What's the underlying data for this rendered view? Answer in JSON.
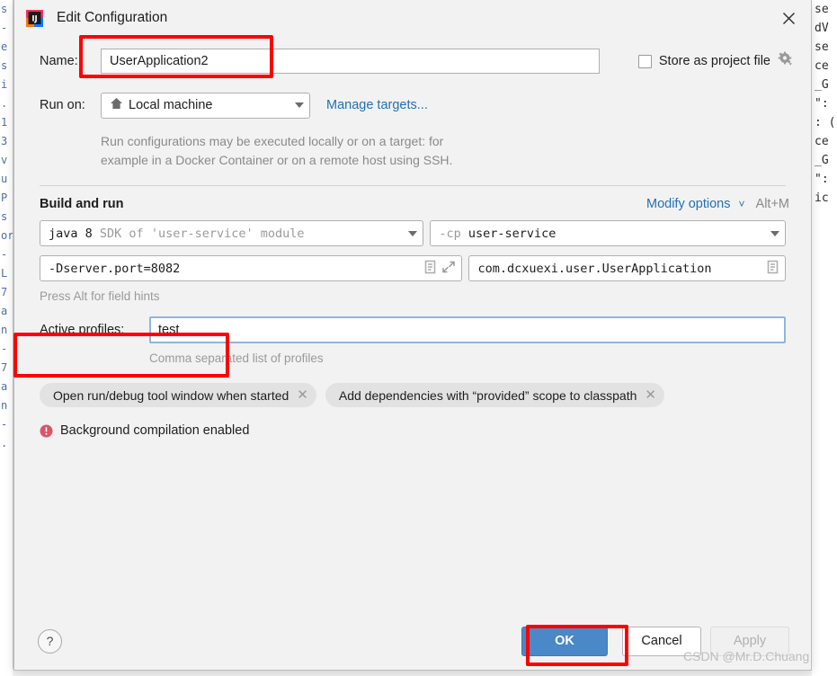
{
  "window": {
    "title": "Edit Configuration",
    "app_icon": "intellij-idea-icon",
    "close_icon": "close-icon"
  },
  "name_row": {
    "label": "Name:",
    "value": "UserApplication2",
    "placeholder": "Name",
    "store_as_project_file": {
      "label": "Store as project file",
      "checked": false,
      "gear_icon": "gear-icon"
    }
  },
  "run_on_row": {
    "label": "Run on:",
    "value": "Local machine",
    "icon": "home-icon",
    "manage_targets_link": "Manage targets..."
  },
  "description": {
    "line1": "Run configurations may be executed locally or on a target: for",
    "line2": "example in a Docker Container or on a remote host using SSH."
  },
  "build_and_run": {
    "title": "Build and run",
    "modify_options_link": "Modify options",
    "modify_options_caret": "chevron-down-icon",
    "shortcut": "Alt+M",
    "sdk_field": {
      "value_strong": "java 8",
      "value_dim": "SDK of 'user-service' module"
    },
    "classpath_field": {
      "value_dim": "-cp",
      "value_strong": "user-service"
    },
    "vm_options_field": {
      "value": "-Dserver.port=8082",
      "icons": [
        "macro-list-icon",
        "expand-icon"
      ]
    },
    "main_class_field": {
      "value": "com.dcxuexi.user.UserApplication",
      "icons": [
        "macro-list-icon"
      ]
    },
    "field_hint": "Press Alt for field hints"
  },
  "active_profiles": {
    "label": "Active profiles:",
    "value": "test",
    "hint": "Comma separated list of profiles"
  },
  "option_chips": [
    {
      "label": "Open run/debug tool window when started",
      "remove_icon": "close-icon"
    },
    {
      "label": "Add dependencies with “provided” scope to classpath",
      "remove_icon": "close-icon"
    }
  ],
  "status": {
    "icon": "error-icon",
    "text": "Background compilation enabled",
    "icon_color": "#d9566a"
  },
  "footer": {
    "help_label": "?",
    "ok_label": "OK",
    "cancel_label": "Cancel",
    "apply_label": "Apply",
    "ok_color": "#4a88c7"
  },
  "annotations": {
    "highlight_color": "#ff0000",
    "boxes": [
      "name-field-highlight",
      "active-profiles-highlight",
      "ok-button-highlight"
    ]
  },
  "watermark": "CSDN @Mr.D.Chuang",
  "backdrop": {
    "gutter_lines": [
      "s",
      "-",
      "e",
      "s",
      "i",
      ".",
      "1",
      "3",
      "v",
      "u",
      "",
      "",
      "P",
      "s",
      "",
      "or",
      "-",
      "L",
      "7",
      "a",
      "n",
      "-",
      "7",
      "a",
      "n",
      "-",
      "."
    ],
    "right_lines": [
      "se",
      "",
      "",
      "",
      "",
      "",
      "",
      "",
      "",
      "",
      "",
      "",
      "",
      "",
      "",
      "",
      "",
      "dV",
      "se",
      "ce",
      "_G",
      "\":",
      ": (",
      "ce",
      "_G",
      "\":",
      "ic"
    ]
  }
}
